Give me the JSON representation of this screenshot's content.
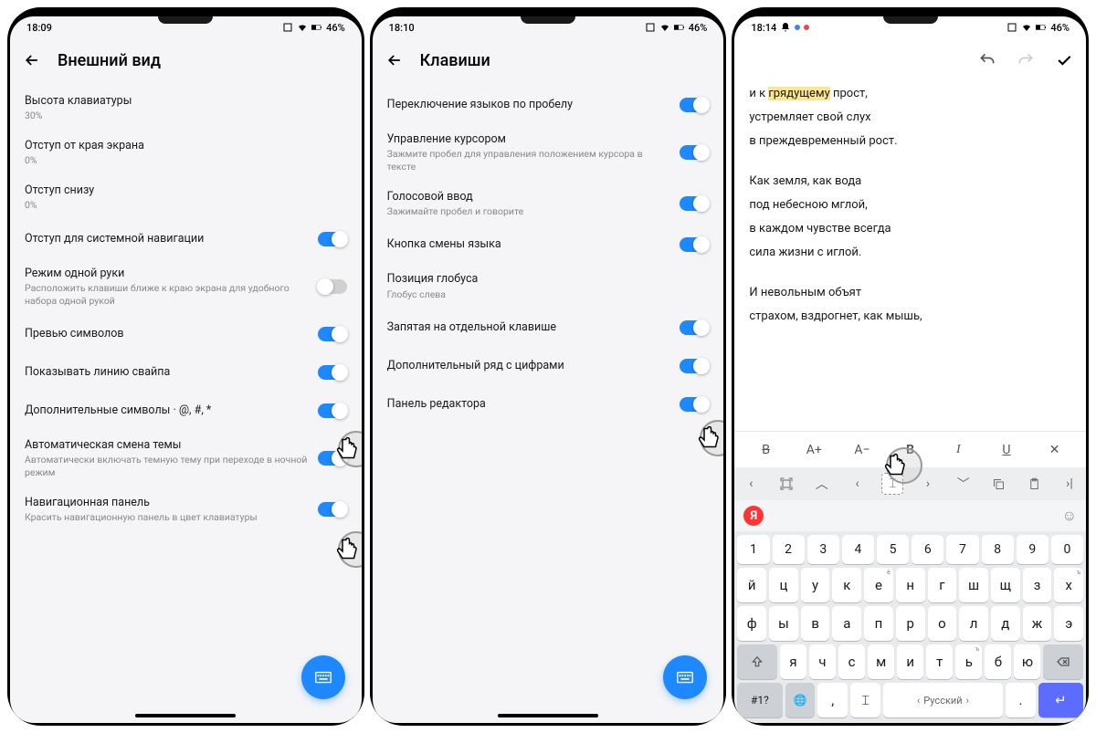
{
  "phone1": {
    "statusbar": {
      "time": "18:09",
      "battery": "46%"
    },
    "header": {
      "title": "Внешний вид"
    },
    "items": [
      {
        "title": "Высота клавиатуры",
        "sub": "30%",
        "toggle": null
      },
      {
        "title": "Отступ от края экрана",
        "sub": "0%",
        "toggle": null
      },
      {
        "title": "Отступ снизу",
        "sub": "0%",
        "toggle": null
      },
      {
        "title": "Отступ для системной навигации",
        "sub": "",
        "toggle": true
      },
      {
        "title": "Режим одной руки",
        "sub": "Расположить клавиши ближе к краю экрана для удобного набора одной рукой",
        "toggle": false
      },
      {
        "title": "Превью символов",
        "sub": "",
        "toggle": true
      },
      {
        "title": "Показывать линию свайпа",
        "sub": "",
        "toggle": true
      },
      {
        "title": "Дополнительные символы · @, #, *",
        "sub": "",
        "toggle": true
      },
      {
        "title": "Автоматическая смена темы",
        "sub": "Автоматически включать темную тему при переходе в ночной режим",
        "toggle": true
      },
      {
        "title": "Навигационная панель",
        "sub": "Красить навигационную панель в цвет клавиатуры",
        "toggle": true
      }
    ]
  },
  "phone2": {
    "statusbar": {
      "time": "18:10",
      "battery": "46%"
    },
    "header": {
      "title": "Клавиши"
    },
    "items": [
      {
        "title": "Переключение языков по пробелу",
        "sub": "",
        "toggle": true
      },
      {
        "title": "Управление курсором",
        "sub": "Зажмите пробел для управления положением курсора в тексте",
        "toggle": true
      },
      {
        "title": "Голосовой ввод",
        "sub": "Зажимайте пробел и говорите",
        "toggle": true
      },
      {
        "title": "Кнопка смены языка",
        "sub": "",
        "toggle": true
      },
      {
        "title": "Позиция глобуса",
        "sub": "Глобус слева",
        "toggle": null
      },
      {
        "title": "Запятая на отдельной клавише",
        "sub": "",
        "toggle": true
      },
      {
        "title": "Дополнительный ряд с цифрами",
        "sub": "",
        "toggle": true
      },
      {
        "title": "Панель редактора",
        "sub": "",
        "toggle": true
      }
    ]
  },
  "phone3": {
    "statusbar": {
      "time": "18:14",
      "battery": "46%"
    },
    "editor": {
      "lines": [
        "и к грядущему прост,",
        "устремляет свой слух",
        "в преждевременный рост."
      ],
      "stanza2": [
        "Как земля, как вода",
        "под небесною мглой,",
        "в каждом чувстве всегда",
        "сила жизни с иглой."
      ],
      "stanza3": [
        "И невольным объят",
        "страхом, вздрогнет, как мышь,"
      ],
      "highlight_word": "грядущему"
    },
    "formatbar": {
      "strike": "B̶",
      "aplus": "A+",
      "aminus": "A−",
      "bold": "B",
      "italic": "I",
      "underline": "U",
      "close": "✕"
    },
    "suggestion": {
      "ya": "Я"
    },
    "keyboard": {
      "row_num": [
        "1",
        "2",
        "3",
        "4",
        "5",
        "6",
        "7",
        "8",
        "9",
        "0"
      ],
      "row1": [
        "й",
        "ц",
        "у",
        "к",
        "е",
        "н",
        "г",
        "ш",
        "щ",
        "з",
        "х"
      ],
      "row1_sup": [
        "",
        "",
        "",
        "",
        "ё",
        "",
        "",
        "",
        "",
        "",
        "ъ"
      ],
      "row2": [
        "ф",
        "ы",
        "в",
        "а",
        "п",
        "р",
        "о",
        "л",
        "д",
        "ж",
        "э"
      ],
      "row3": [
        "я",
        "ч",
        "с",
        "м",
        "и",
        "т",
        "ь",
        "б",
        "ю"
      ],
      "row3_sup": [
        "",
        "",
        "",
        "",
        "",
        "",
        "ъ",
        "",
        ""
      ],
      "bottom": {
        "sym": "#1?",
        "comma": ",",
        "space": "Русский",
        "dot": "."
      }
    }
  }
}
